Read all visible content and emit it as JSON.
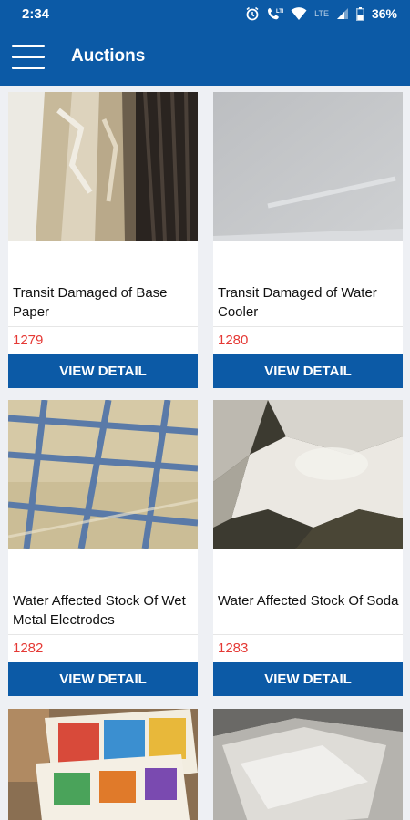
{
  "status_bar": {
    "time": "2:34",
    "network": "LTE",
    "battery": "36%",
    "icons": [
      "alarm-icon",
      "volte-call-icon",
      "wifi-icon",
      "signal-icon",
      "battery-icon"
    ]
  },
  "header": {
    "title": "Auctions",
    "menu_icon": "hamburger-menu-icon"
  },
  "colors": {
    "primary": "#0c5aa6",
    "lot_number": "#e53935",
    "background": "#eef0f4"
  },
  "auctions": [
    {
      "title": "Transit Damaged of Base Paper",
      "lot": "1279",
      "button": "VIEW DETAIL",
      "image": "damaged-paper-rolls"
    },
    {
      "title": "Transit Damaged of Water Cooler",
      "lot": "1280",
      "button": "VIEW DETAIL",
      "image": "grey-cooler-surface"
    },
    {
      "title": "Water Affected Stock Of Wet Metal Electrodes",
      "lot": "1282",
      "button": "VIEW DETAIL",
      "image": "taped-electrode-boxes"
    },
    {
      "title": "Water Affected Stock Of Soda",
      "lot": "1283",
      "button": "VIEW DETAIL",
      "image": "soda-sack"
    },
    {
      "title": "",
      "lot": "",
      "button": "",
      "image": "books-stack"
    },
    {
      "title": "",
      "lot": "",
      "button": "",
      "image": "foil-wrapped-goods"
    }
  ]
}
